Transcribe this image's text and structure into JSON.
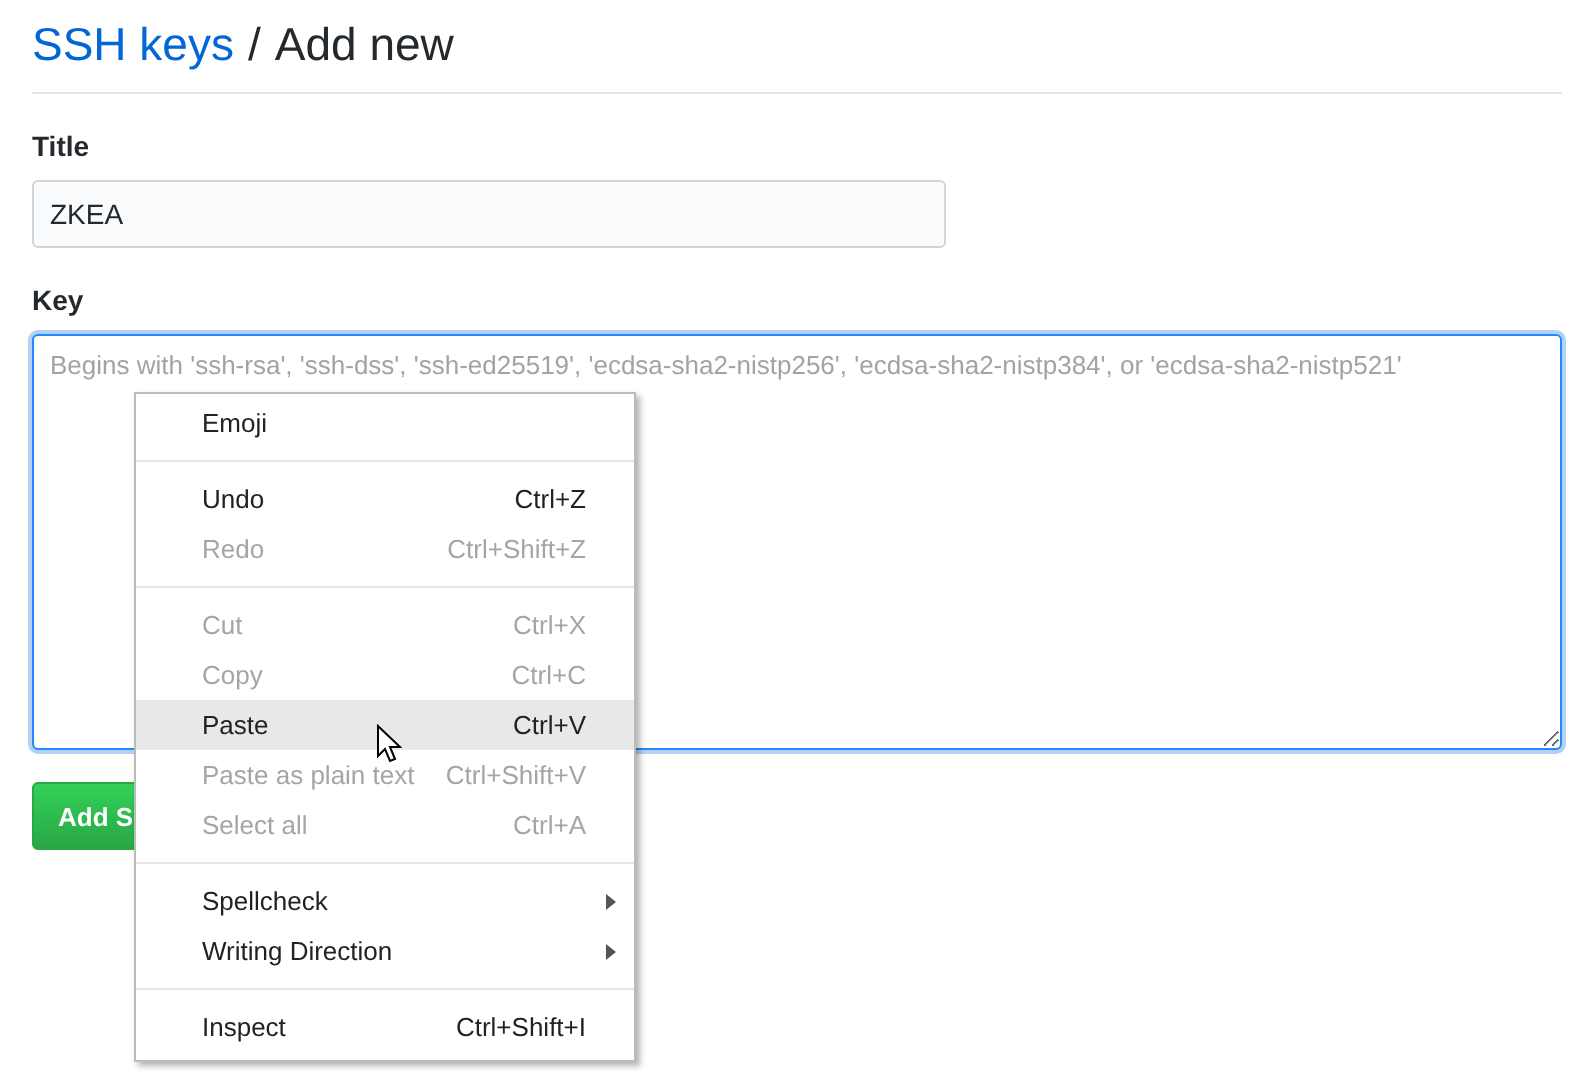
{
  "breadcrumb": {
    "link": "SSH keys",
    "separator": "/",
    "current": "Add new"
  },
  "title_field": {
    "label": "Title",
    "value": "ZKEA"
  },
  "key_field": {
    "label": "Key",
    "placeholder": "Begins with 'ssh-rsa', 'ssh-dss', 'ssh-ed25519', 'ecdsa-sha2-nistp256', 'ecdsa-sha2-nistp384', or 'ecdsa-sha2-nistp521'",
    "focused": true
  },
  "submit_button": {
    "label": "Add S"
  },
  "context_menu": {
    "items": [
      {
        "kind": "item",
        "label": "Emoji",
        "disabled": false,
        "selected": false,
        "submenu": false
      },
      {
        "kind": "separator"
      },
      {
        "kind": "item",
        "label": "Undo",
        "shortcut": "Ctrl+Z",
        "disabled": false,
        "selected": false,
        "submenu": false
      },
      {
        "kind": "item",
        "label": "Redo",
        "shortcut": "Ctrl+Shift+Z",
        "disabled": true,
        "selected": false,
        "submenu": false
      },
      {
        "kind": "separator"
      },
      {
        "kind": "item",
        "label": "Cut",
        "shortcut": "Ctrl+X",
        "disabled": true,
        "selected": false,
        "submenu": false
      },
      {
        "kind": "item",
        "label": "Copy",
        "shortcut": "Ctrl+C",
        "disabled": true,
        "selected": false,
        "submenu": false
      },
      {
        "kind": "item",
        "label": "Paste",
        "shortcut": "Ctrl+V",
        "disabled": false,
        "selected": true,
        "submenu": false
      },
      {
        "kind": "item",
        "label": "Paste as plain text",
        "shortcut": "Ctrl+Shift+V",
        "disabled": true,
        "selected": false,
        "submenu": false
      },
      {
        "kind": "item",
        "label": "Select all",
        "shortcut": "Ctrl+A",
        "disabled": true,
        "selected": false,
        "submenu": false
      },
      {
        "kind": "separator"
      },
      {
        "kind": "item",
        "label": "Spellcheck",
        "disabled": false,
        "selected": false,
        "submenu": true
      },
      {
        "kind": "item",
        "label": "Writing Direction",
        "disabled": false,
        "selected": false,
        "submenu": true
      },
      {
        "kind": "separator"
      },
      {
        "kind": "item",
        "label": "Inspect",
        "shortcut": "Ctrl+Shift+I",
        "disabled": false,
        "selected": false,
        "submenu": false
      }
    ]
  }
}
